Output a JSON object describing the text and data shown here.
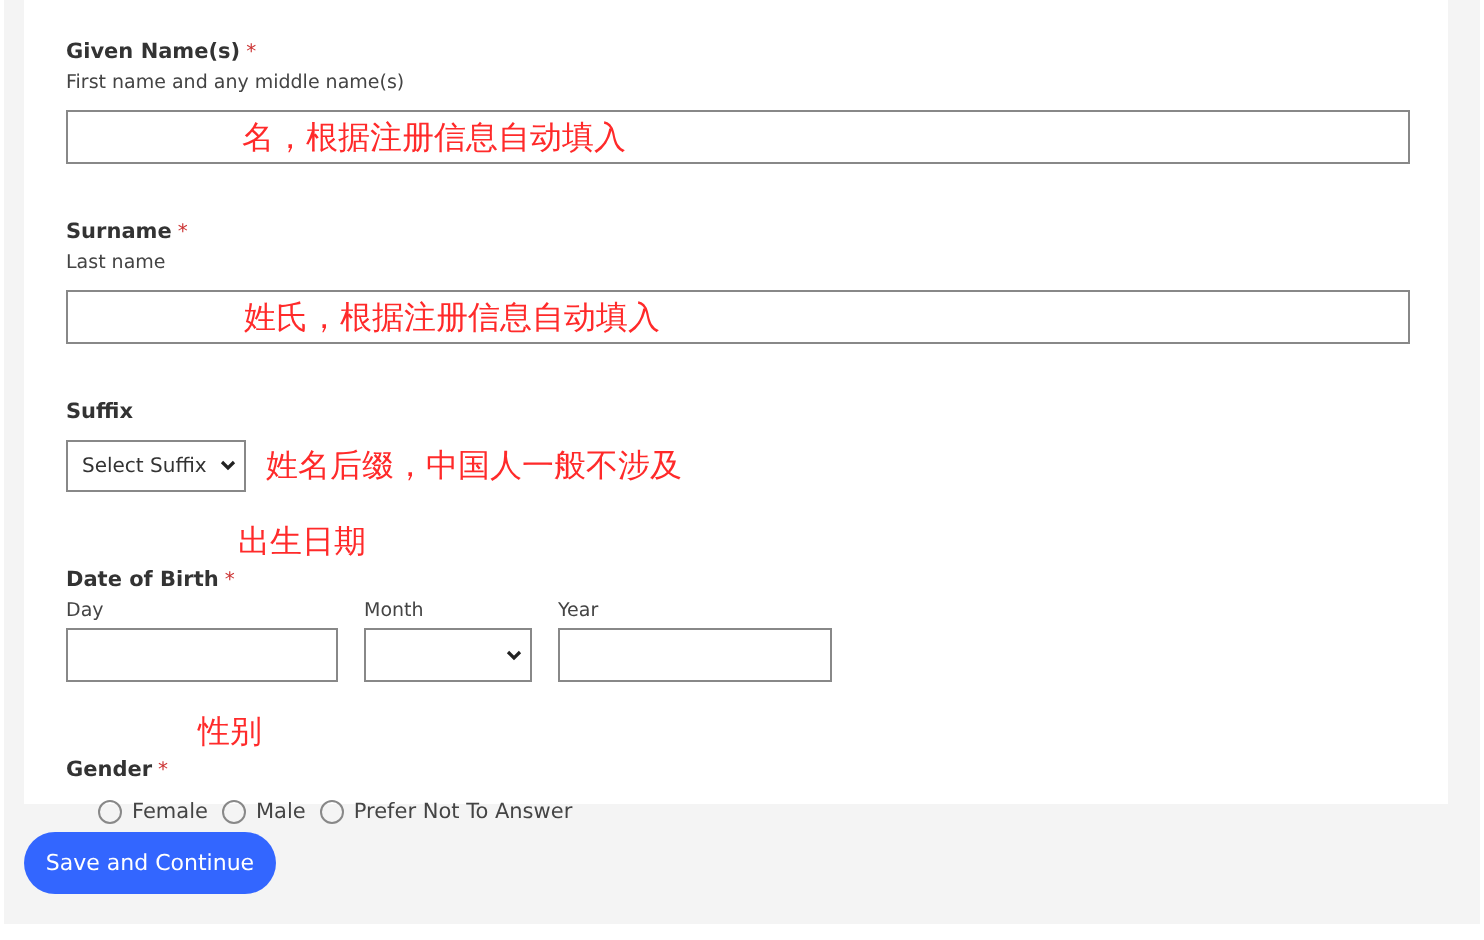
{
  "fields": [
    {
      "kind": "text",
      "label": "Given Name(s)",
      "required_mark": "*",
      "hint": "First name and any middle name(s)",
      "note": "名，根据注册信息自动填入"
    },
    {
      "kind": "text",
      "label": "Surname",
      "required_mark": "*",
      "hint": "Last name",
      "note": "姓氏，根据注册信息自动填入"
    },
    {
      "kind": "select",
      "label": "Suffix",
      "value": "Select Suffix",
      "note": "姓名后缀，中国人一般不涉及"
    },
    {
      "kind": "date",
      "label": "Date of Birth",
      "required_mark": "*",
      "note": "出生日期",
      "parts": [
        {
          "kind": "input",
          "label": "Day"
        },
        {
          "kind": "select",
          "label": "Month"
        },
        {
          "kind": "input",
          "label": "Year"
        }
      ]
    },
    {
      "kind": "radio",
      "label": "Gender",
      "required_mark": "*",
      "note": "性别",
      "options": [
        {
          "label": "Female",
          "selected": false
        },
        {
          "label": "Male",
          "selected": false
        },
        {
          "label": "Prefer Not To Answer",
          "selected": false
        }
      ]
    }
  ],
  "button": "Save and Continue"
}
